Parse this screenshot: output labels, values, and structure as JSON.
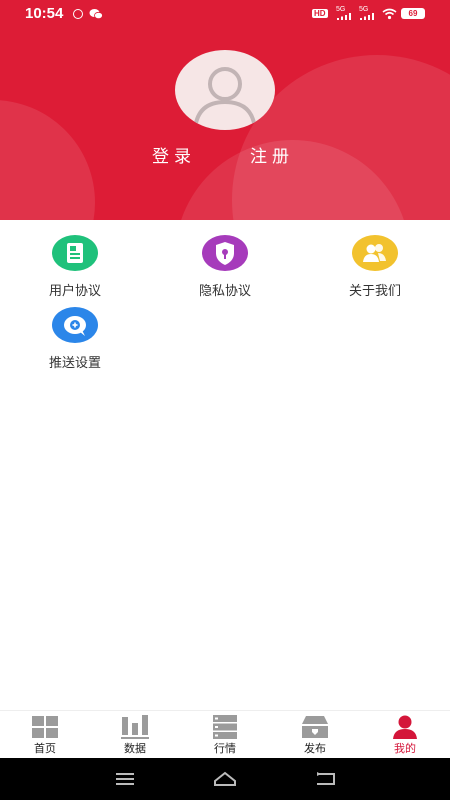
{
  "status_bar": {
    "time": "10:54",
    "network_1": "5G",
    "network_2": "5G",
    "hd": "HD",
    "battery": "69"
  },
  "profile": {
    "login_label": "登录",
    "register_label": "注册"
  },
  "menu": [
    {
      "label": "用户协议",
      "icon": "user-agreement-icon",
      "color": "#1fc17b"
    },
    {
      "label": "隐私协议",
      "icon": "privacy-shield-icon",
      "color": "#a63bbb"
    },
    {
      "label": "关于我们",
      "icon": "about-us-icon",
      "color": "#f2c22e"
    },
    {
      "label": "推送设置",
      "icon": "push-settings-icon",
      "color": "#2b86e9"
    }
  ],
  "tabbar": {
    "items": [
      {
        "label": "首页",
        "icon": "home-grid-icon"
      },
      {
        "label": "数据",
        "icon": "data-bars-icon"
      },
      {
        "label": "行情",
        "icon": "market-list-icon"
      },
      {
        "label": "发布",
        "icon": "publish-tray-icon"
      },
      {
        "label": "我的",
        "icon": "profile-person-icon"
      }
    ],
    "active_index": 4,
    "active_color": "#d4163a",
    "inactive_icon_color": "#9b9b9b"
  },
  "theme": {
    "header_color": "#dd1c36"
  }
}
